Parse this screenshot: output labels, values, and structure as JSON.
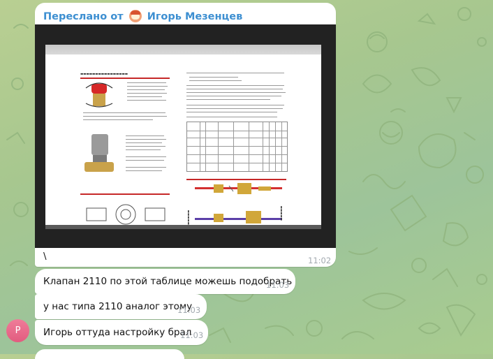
{
  "chat": {
    "forwarded_message": {
      "header_prefix": "Переслано от",
      "sender_name": "Игорь Мезенцев",
      "caption": "\\",
      "time": "11:02"
    },
    "messages": [
      {
        "text": "Клапан 2110 по этой таблице можешь подобрать",
        "time": "11:03"
      },
      {
        "text": "у нас типа 2110 аналог этому",
        "time": "11:03"
      },
      {
        "text": "Игорь оттуда настройку брал",
        "time": "11:03"
      }
    ],
    "sender_avatar_letter": "Р",
    "colors": {
      "header_link": "#3d8fd1",
      "avatar": "#e8698a",
      "time": "#a3aab0",
      "background": "#a9c890"
    }
  }
}
